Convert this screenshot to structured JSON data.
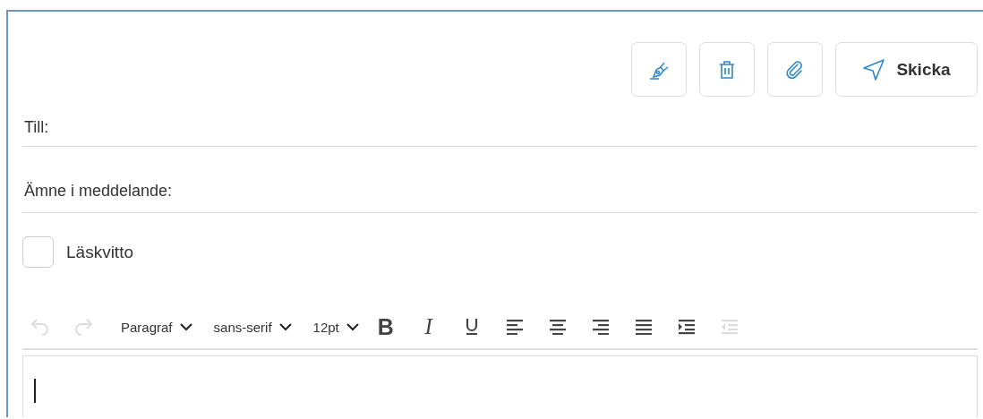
{
  "actions": [
    {
      "kind": "sign"
    },
    {
      "kind": "delete"
    },
    {
      "kind": "attach"
    },
    {
      "kind": "send",
      "label": "Skicka"
    }
  ],
  "fields": [
    {
      "label": "Till:"
    },
    {
      "label": "Ämne i meddelande:"
    }
  ],
  "read_receipt": {
    "label": "Läskvitto",
    "checked": false
  },
  "toolbar": [
    {
      "kind": "undo",
      "disabled": true
    },
    {
      "kind": "redo",
      "disabled": true
    },
    {
      "kind": "dropdown",
      "label": "Paragraf"
    },
    {
      "kind": "dropdown",
      "label": "sans-serif"
    },
    {
      "kind": "dropdown",
      "label": "12pt"
    },
    {
      "kind": "bold",
      "label": "B",
      "disabled": false
    },
    {
      "kind": "italic",
      "label": "I",
      "disabled": false
    },
    {
      "kind": "underline",
      "disabled": false
    },
    {
      "kind": "align-left",
      "disabled": false
    },
    {
      "kind": "align-center",
      "disabled": false
    },
    {
      "kind": "align-right",
      "disabled": false
    },
    {
      "kind": "justify",
      "disabled": false
    },
    {
      "kind": "indent",
      "disabled": false
    },
    {
      "kind": "outdent",
      "disabled": true
    }
  ]
}
